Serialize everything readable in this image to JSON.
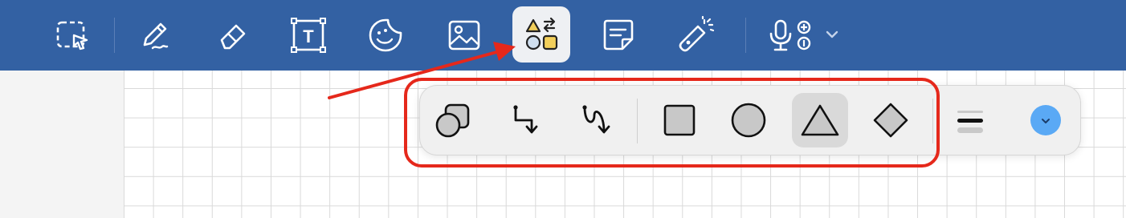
{
  "toolbar": {
    "background": "#3361a3",
    "tools": [
      {
        "name": "lasso-select",
        "icon": "lasso-select-icon"
      },
      {
        "name": "pen",
        "icon": "pen-icon"
      },
      {
        "name": "eraser",
        "icon": "eraser-icon"
      },
      {
        "name": "text-box",
        "icon": "text-box-icon",
        "glyph": "T"
      },
      {
        "name": "sticker",
        "icon": "sticker-icon"
      },
      {
        "name": "image",
        "icon": "image-icon"
      },
      {
        "name": "shapes",
        "icon": "shapes-icon",
        "active": true
      },
      {
        "name": "sticky-note",
        "icon": "sticky-note-icon"
      },
      {
        "name": "laser-pointer",
        "icon": "laser-pointer-icon"
      },
      {
        "name": "audio-record",
        "icon": "microphone-icon"
      }
    ]
  },
  "shapes_popover": {
    "tools": [
      {
        "name": "shape-library",
        "icon": "overlapping-shapes-icon"
      },
      {
        "name": "elbow-connector",
        "icon": "elbow-arrow-icon"
      },
      {
        "name": "curved-connector",
        "icon": "curved-arrow-icon"
      },
      {
        "name": "square",
        "icon": "square-icon"
      },
      {
        "name": "circle",
        "icon": "circle-icon"
      },
      {
        "name": "triangle",
        "icon": "triangle-icon",
        "selected": true
      },
      {
        "name": "diamond",
        "icon": "diamond-icon"
      },
      {
        "name": "line-thickness",
        "icon": "line-thickness-icon"
      },
      {
        "name": "color",
        "icon": "color-swatch-icon",
        "color": "#5aa9f5"
      }
    ],
    "shape_fill": "#c8c8c8"
  },
  "annotation": {
    "color": "#e5281b"
  }
}
